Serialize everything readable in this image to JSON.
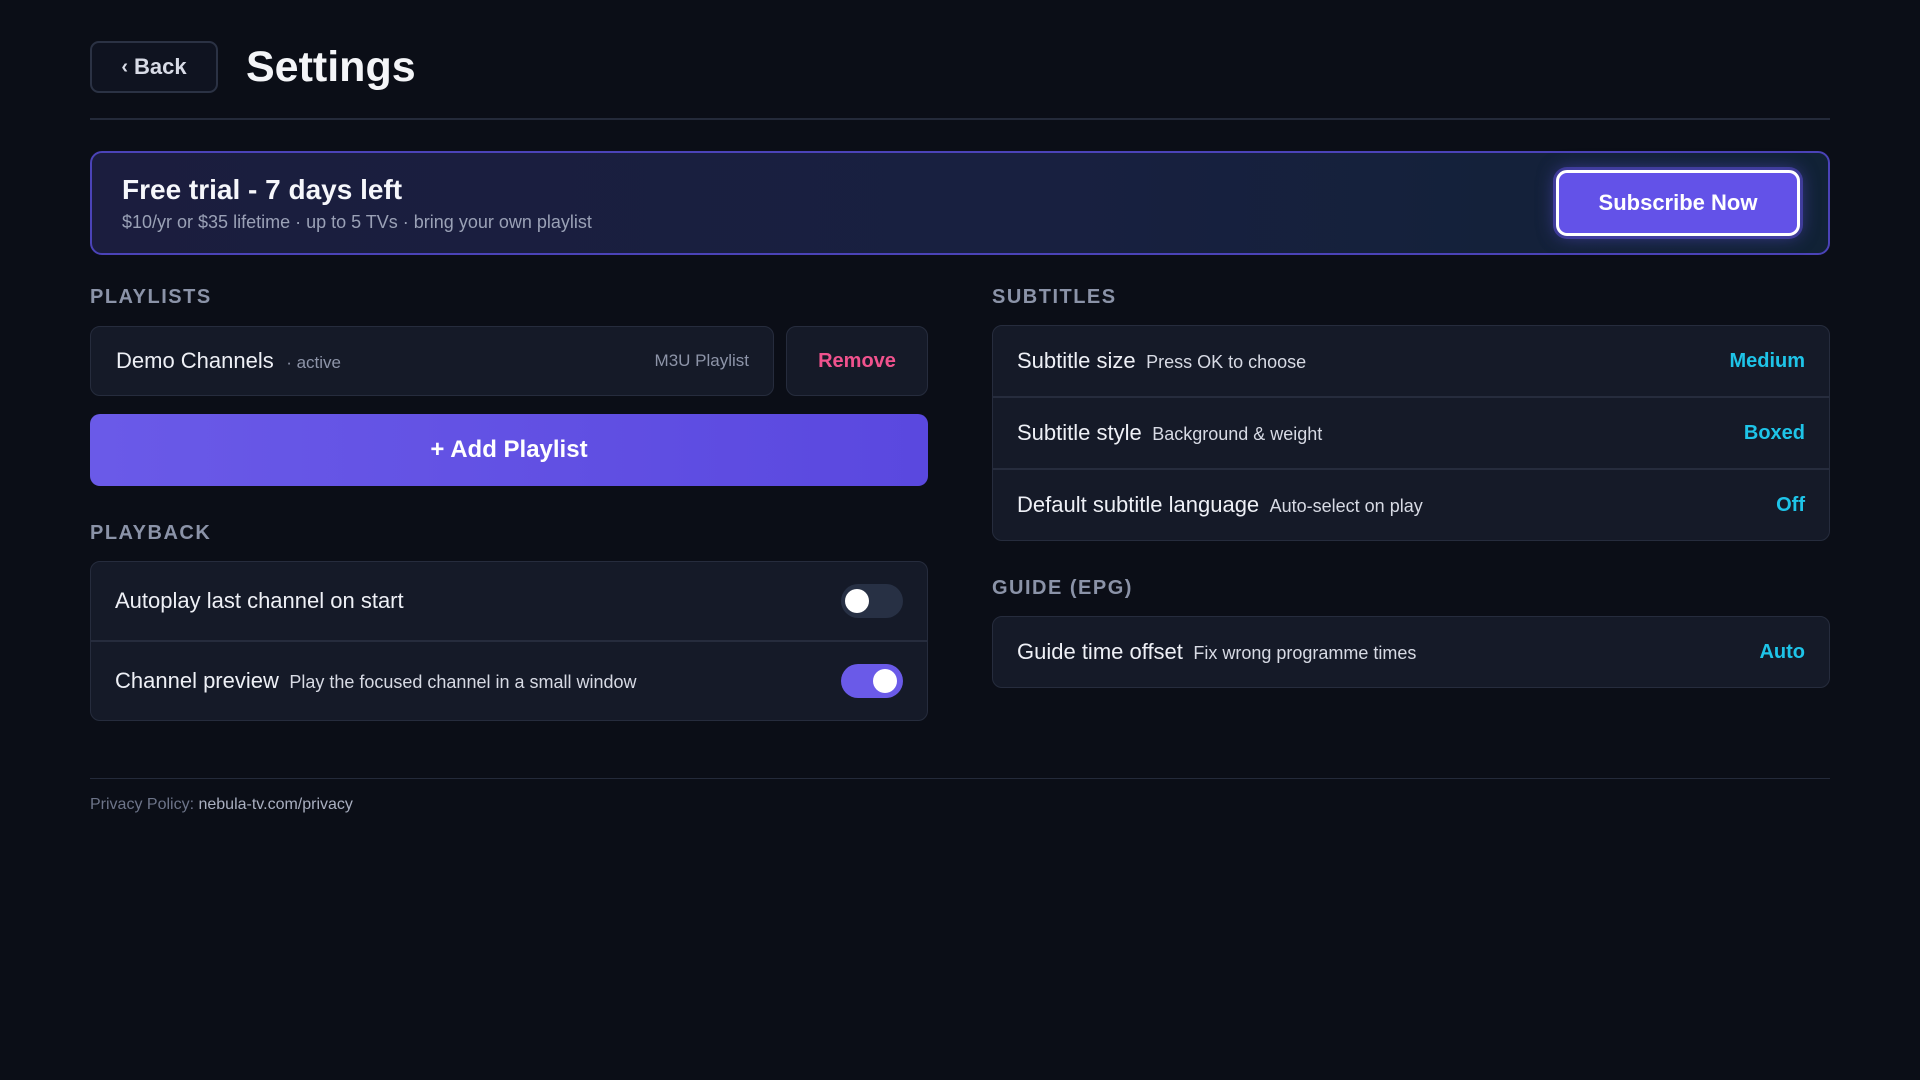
{
  "header": {
    "back_label": "Back",
    "back_icon": "chevron-left-icon",
    "title": "Settings"
  },
  "trial": {
    "title": "Free trial - 7 days left",
    "subtitle": "$10/yr or $35 lifetime · up to 5 TVs · bring your own playlist",
    "subscribe_label": "Subscribe Now"
  },
  "playlists": {
    "section_label": "PLAYLISTS",
    "items": [
      {
        "name": "Demo Channels",
        "status": "· active",
        "type": "M3U Playlist",
        "remove_label": "Remove"
      }
    ],
    "add_label": "+ Add Playlist"
  },
  "playback": {
    "section_label": "PLAYBACK",
    "items": [
      {
        "label": "Autoplay last channel on start",
        "hint": "",
        "enabled": false
      },
      {
        "label": "Channel preview",
        "hint": "Play the focused channel in a small window",
        "enabled": true
      }
    ]
  },
  "subtitles": {
    "section_label": "SUBTITLES",
    "items": [
      {
        "label": "Subtitle size",
        "hint": "Press OK to choose",
        "value": "Medium"
      },
      {
        "label": "Subtitle style",
        "hint": "Background & weight",
        "value": "Boxed"
      },
      {
        "label": "Default subtitle language",
        "hint": "Auto-select on play",
        "value": "Off"
      }
    ]
  },
  "guide": {
    "section_label": "GUIDE (EPG)",
    "items": [
      {
        "label": "Guide time offset",
        "hint": "Fix wrong programme times",
        "value": "Auto"
      }
    ]
  },
  "footer": {
    "privacy_label": "Privacy Policy:",
    "privacy_link": "nebula-tv.com/privacy"
  },
  "colors": {
    "background": "#0b0e17",
    "accent": "#6352e8",
    "value_text": "#1ec4e8",
    "danger": "#f0528d"
  }
}
